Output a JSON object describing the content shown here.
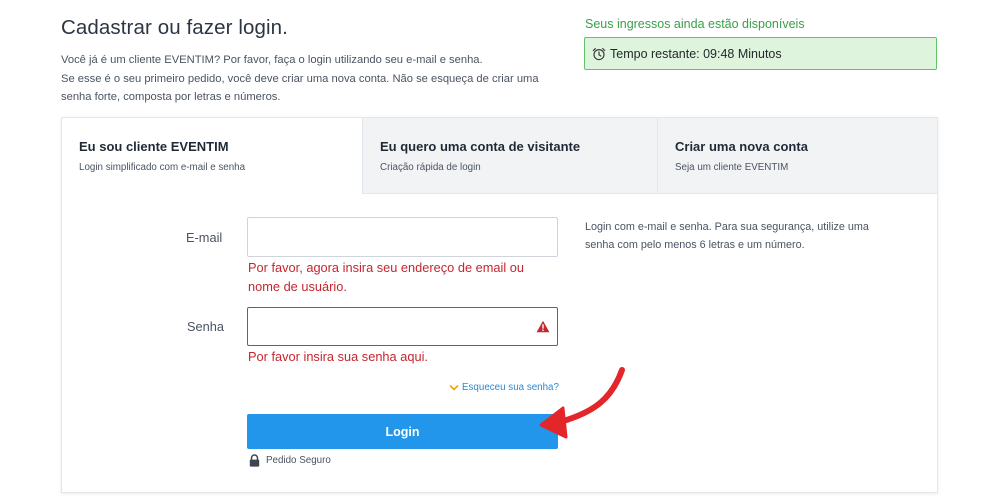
{
  "header": {
    "title": "Cadastrar ou fazer login.",
    "intro_lines": [
      "Você já é um cliente EVENTIM? Por favor, faça o login utilizando seu e-mail e senha.",
      "Se esse é o seu primeiro pedido, você deve criar uma nova conta. Não se esqueça de criar uma",
      "senha forte, composta por letras e números."
    ]
  },
  "timer": {
    "caption": "Seus ingressos ainda estão disponíveis",
    "text": "Tempo restante: 09:48 Minutos",
    "icon": "alarm-clock-icon"
  },
  "tabs": [
    {
      "title": "Eu sou cliente EVENTIM",
      "subtitle": "Login simplificado com e-mail e senha",
      "active": true
    },
    {
      "title": "Eu quero uma conta de visitante",
      "subtitle": "Criação rápida de login",
      "active": false
    },
    {
      "title": "Criar uma nova conta",
      "subtitle": "Seja um cliente EVENTIM",
      "active": false
    }
  ],
  "form": {
    "email_label": "E-mail",
    "email_value": "",
    "email_error_line1": "Por favor, agora insira seu endereço de email ou",
    "email_error_line2": "nome de usuário.",
    "password_label": "Senha",
    "password_value": "",
    "password_error": "Por favor insira sua senha aqui.",
    "help_text": "Login com e-mail e senha. Para sua segurança, utilize uma senha com pelo menos 6 letras e um número.",
    "forgot_label": "Esqueceu sua senha?",
    "login_label": "Login",
    "secure_label": "Pedido Seguro"
  },
  "colors": {
    "primary": "#2196ea",
    "error": "#c6262e",
    "success_bg": "#dff4dc",
    "success_border": "#62c26a",
    "success_text": "#3aa048",
    "annotation_arrow": "#e3262a"
  }
}
